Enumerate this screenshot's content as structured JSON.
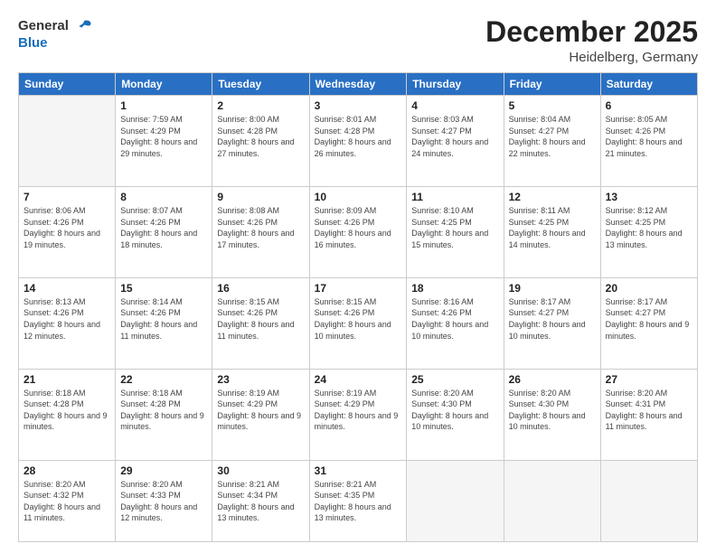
{
  "logo": {
    "general": "General",
    "blue": "Blue"
  },
  "header": {
    "title": "December 2025",
    "subtitle": "Heidelberg, Germany"
  },
  "weekdays": [
    "Sunday",
    "Monday",
    "Tuesday",
    "Wednesday",
    "Thursday",
    "Friday",
    "Saturday"
  ],
  "days": [
    {
      "date": "",
      "sunrise": "",
      "sunset": "",
      "daylight": ""
    },
    {
      "date": "1",
      "sunrise": "Sunrise: 7:59 AM",
      "sunset": "Sunset: 4:29 PM",
      "daylight": "Daylight: 8 hours and 29 minutes."
    },
    {
      "date": "2",
      "sunrise": "Sunrise: 8:00 AM",
      "sunset": "Sunset: 4:28 PM",
      "daylight": "Daylight: 8 hours and 27 minutes."
    },
    {
      "date": "3",
      "sunrise": "Sunrise: 8:01 AM",
      "sunset": "Sunset: 4:28 PM",
      "daylight": "Daylight: 8 hours and 26 minutes."
    },
    {
      "date": "4",
      "sunrise": "Sunrise: 8:03 AM",
      "sunset": "Sunset: 4:27 PM",
      "daylight": "Daylight: 8 hours and 24 minutes."
    },
    {
      "date": "5",
      "sunrise": "Sunrise: 8:04 AM",
      "sunset": "Sunset: 4:27 PM",
      "daylight": "Daylight: 8 hours and 22 minutes."
    },
    {
      "date": "6",
      "sunrise": "Sunrise: 8:05 AM",
      "sunset": "Sunset: 4:26 PM",
      "daylight": "Daylight: 8 hours and 21 minutes."
    },
    {
      "date": "7",
      "sunrise": "Sunrise: 8:06 AM",
      "sunset": "Sunset: 4:26 PM",
      "daylight": "Daylight: 8 hours and 19 minutes."
    },
    {
      "date": "8",
      "sunrise": "Sunrise: 8:07 AM",
      "sunset": "Sunset: 4:26 PM",
      "daylight": "Daylight: 8 hours and 18 minutes."
    },
    {
      "date": "9",
      "sunrise": "Sunrise: 8:08 AM",
      "sunset": "Sunset: 4:26 PM",
      "daylight": "Daylight: 8 hours and 17 minutes."
    },
    {
      "date": "10",
      "sunrise": "Sunrise: 8:09 AM",
      "sunset": "Sunset: 4:26 PM",
      "daylight": "Daylight: 8 hours and 16 minutes."
    },
    {
      "date": "11",
      "sunrise": "Sunrise: 8:10 AM",
      "sunset": "Sunset: 4:25 PM",
      "daylight": "Daylight: 8 hours and 15 minutes."
    },
    {
      "date": "12",
      "sunrise": "Sunrise: 8:11 AM",
      "sunset": "Sunset: 4:25 PM",
      "daylight": "Daylight: 8 hours and 14 minutes."
    },
    {
      "date": "13",
      "sunrise": "Sunrise: 8:12 AM",
      "sunset": "Sunset: 4:25 PM",
      "daylight": "Daylight: 8 hours and 13 minutes."
    },
    {
      "date": "14",
      "sunrise": "Sunrise: 8:13 AM",
      "sunset": "Sunset: 4:26 PM",
      "daylight": "Daylight: 8 hours and 12 minutes."
    },
    {
      "date": "15",
      "sunrise": "Sunrise: 8:14 AM",
      "sunset": "Sunset: 4:26 PM",
      "daylight": "Daylight: 8 hours and 11 minutes."
    },
    {
      "date": "16",
      "sunrise": "Sunrise: 8:15 AM",
      "sunset": "Sunset: 4:26 PM",
      "daylight": "Daylight: 8 hours and 11 minutes."
    },
    {
      "date": "17",
      "sunrise": "Sunrise: 8:15 AM",
      "sunset": "Sunset: 4:26 PM",
      "daylight": "Daylight: 8 hours and 10 minutes."
    },
    {
      "date": "18",
      "sunrise": "Sunrise: 8:16 AM",
      "sunset": "Sunset: 4:26 PM",
      "daylight": "Daylight: 8 hours and 10 minutes."
    },
    {
      "date": "19",
      "sunrise": "Sunrise: 8:17 AM",
      "sunset": "Sunset: 4:27 PM",
      "daylight": "Daylight: 8 hours and 10 minutes."
    },
    {
      "date": "20",
      "sunrise": "Sunrise: 8:17 AM",
      "sunset": "Sunset: 4:27 PM",
      "daylight": "Daylight: 8 hours and 9 minutes."
    },
    {
      "date": "21",
      "sunrise": "Sunrise: 8:18 AM",
      "sunset": "Sunset: 4:28 PM",
      "daylight": "Daylight: 8 hours and 9 minutes."
    },
    {
      "date": "22",
      "sunrise": "Sunrise: 8:18 AM",
      "sunset": "Sunset: 4:28 PM",
      "daylight": "Daylight: 8 hours and 9 minutes."
    },
    {
      "date": "23",
      "sunrise": "Sunrise: 8:19 AM",
      "sunset": "Sunset: 4:29 PM",
      "daylight": "Daylight: 8 hours and 9 minutes."
    },
    {
      "date": "24",
      "sunrise": "Sunrise: 8:19 AM",
      "sunset": "Sunset: 4:29 PM",
      "daylight": "Daylight: 8 hours and 9 minutes."
    },
    {
      "date": "25",
      "sunrise": "Sunrise: 8:20 AM",
      "sunset": "Sunset: 4:30 PM",
      "daylight": "Daylight: 8 hours and 10 minutes."
    },
    {
      "date": "26",
      "sunrise": "Sunrise: 8:20 AM",
      "sunset": "Sunset: 4:30 PM",
      "daylight": "Daylight: 8 hours and 10 minutes."
    },
    {
      "date": "27",
      "sunrise": "Sunrise: 8:20 AM",
      "sunset": "Sunset: 4:31 PM",
      "daylight": "Daylight: 8 hours and 11 minutes."
    },
    {
      "date": "28",
      "sunrise": "Sunrise: 8:20 AM",
      "sunset": "Sunset: 4:32 PM",
      "daylight": "Daylight: 8 hours and 11 minutes."
    },
    {
      "date": "29",
      "sunrise": "Sunrise: 8:20 AM",
      "sunset": "Sunset: 4:33 PM",
      "daylight": "Daylight: 8 hours and 12 minutes."
    },
    {
      "date": "30",
      "sunrise": "Sunrise: 8:21 AM",
      "sunset": "Sunset: 4:34 PM",
      "daylight": "Daylight: 8 hours and 13 minutes."
    },
    {
      "date": "31",
      "sunrise": "Sunrise: 8:21 AM",
      "sunset": "Sunset: 4:35 PM",
      "daylight": "Daylight: 8 hours and 13 minutes."
    }
  ]
}
